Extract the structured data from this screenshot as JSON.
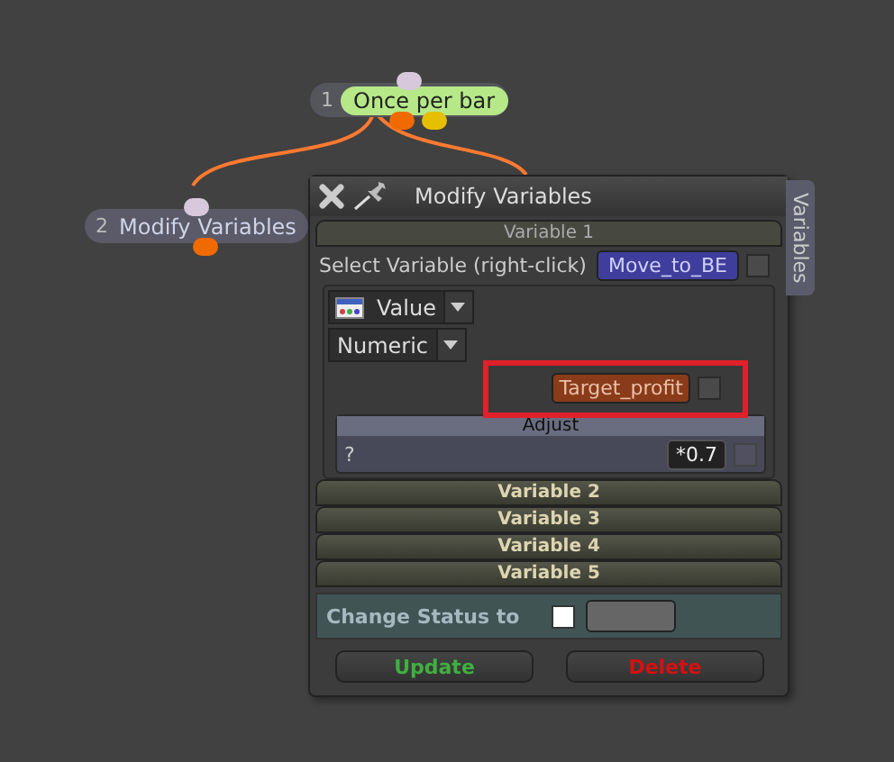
{
  "nodes": [
    {
      "number": "1",
      "label": "Once per bar",
      "kind": "event"
    },
    {
      "number": "2",
      "label": "Modify Variables",
      "kind": "action"
    }
  ],
  "dialog": {
    "title": "Modify Variables",
    "side_tab": "Variables",
    "sections": [
      {
        "title": "Variable 1",
        "expanded": true
      },
      {
        "title": "Variable 2",
        "expanded": false
      },
      {
        "title": "Variable 3",
        "expanded": false
      },
      {
        "title": "Variable 4",
        "expanded": false
      },
      {
        "title": "Variable 5",
        "expanded": false
      }
    ],
    "select_label": "Select Variable (right-click)",
    "variable": "Move_to_BE",
    "variable_checked": false,
    "dropdowns": [
      "Value",
      "Numeric"
    ],
    "target": {
      "label": "Target_profit",
      "checked": false,
      "highlighted": true
    },
    "adjust": {
      "title": "Adjust",
      "label": "?",
      "value": "*0.7",
      "checked": false
    },
    "status": {
      "label": "Change Status to",
      "checked": false
    },
    "buttons": [
      {
        "label": "Update",
        "kind": "update"
      },
      {
        "label": "Delete",
        "kind": "delete"
      }
    ]
  }
}
